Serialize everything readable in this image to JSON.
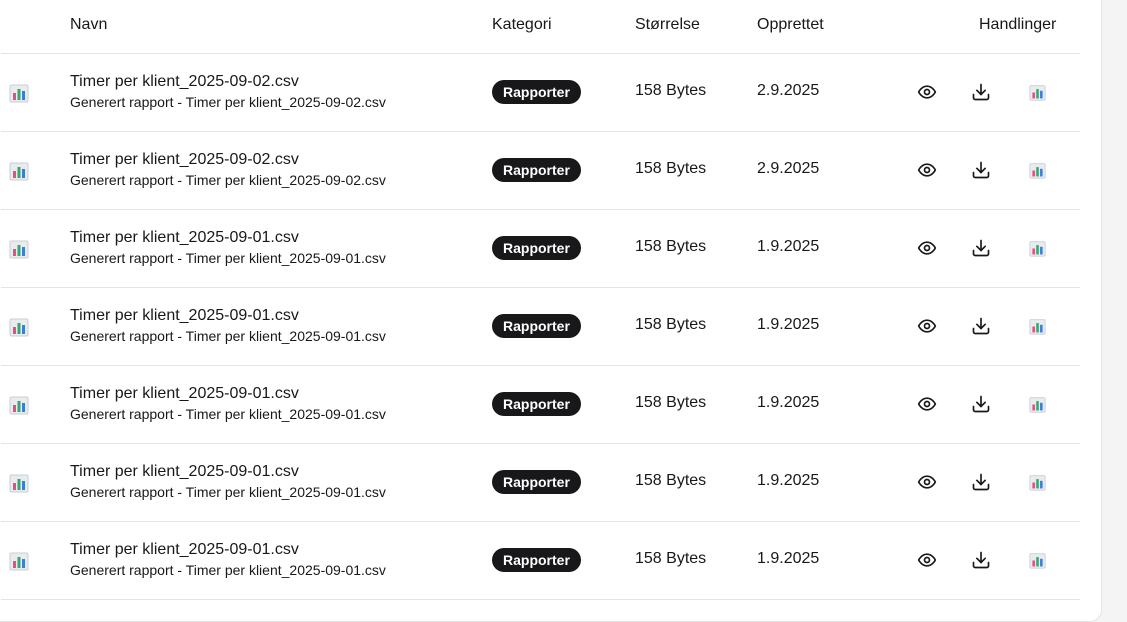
{
  "table": {
    "headers": {
      "name": "Navn",
      "category": "Kategori",
      "size": "Størrelse",
      "created": "Opprettet",
      "actions": "Handlinger"
    },
    "icons": {
      "file_icon": "bar-chart-icon",
      "view_icon": "eye-icon",
      "download_icon": "download-icon",
      "report_icon": "bar-chart-icon"
    },
    "colors": {
      "badge_bg": "#18181b",
      "badge_text": "#ffffff"
    },
    "rows": [
      {
        "title": "Timer per klient_2025-09-02.csv",
        "subtitle": "Generert rapport - Timer per klient_2025-09-02.csv",
        "category": "Rapporter",
        "size": "158 Bytes",
        "created": "2.9.2025"
      },
      {
        "title": "Timer per klient_2025-09-02.csv",
        "subtitle": "Generert rapport - Timer per klient_2025-09-02.csv",
        "category": "Rapporter",
        "size": "158 Bytes",
        "created": "2.9.2025"
      },
      {
        "title": "Timer per klient_2025-09-01.csv",
        "subtitle": "Generert rapport - Timer per klient_2025-09-01.csv",
        "category": "Rapporter",
        "size": "158 Bytes",
        "created": "1.9.2025"
      },
      {
        "title": "Timer per klient_2025-09-01.csv",
        "subtitle": "Generert rapport - Timer per klient_2025-09-01.csv",
        "category": "Rapporter",
        "size": "158 Bytes",
        "created": "1.9.2025"
      },
      {
        "title": "Timer per klient_2025-09-01.csv",
        "subtitle": "Generert rapport - Timer per klient_2025-09-01.csv",
        "category": "Rapporter",
        "size": "158 Bytes",
        "created": "1.9.2025"
      },
      {
        "title": "Timer per klient_2025-09-01.csv",
        "subtitle": "Generert rapport - Timer per klient_2025-09-01.csv",
        "category": "Rapporter",
        "size": "158 Bytes",
        "created": "1.9.2025"
      },
      {
        "title": "Timer per klient_2025-09-01.csv",
        "subtitle": "Generert rapport - Timer per klient_2025-09-01.csv",
        "category": "Rapporter",
        "size": "158 Bytes",
        "created": "1.9.2025"
      }
    ]
  }
}
